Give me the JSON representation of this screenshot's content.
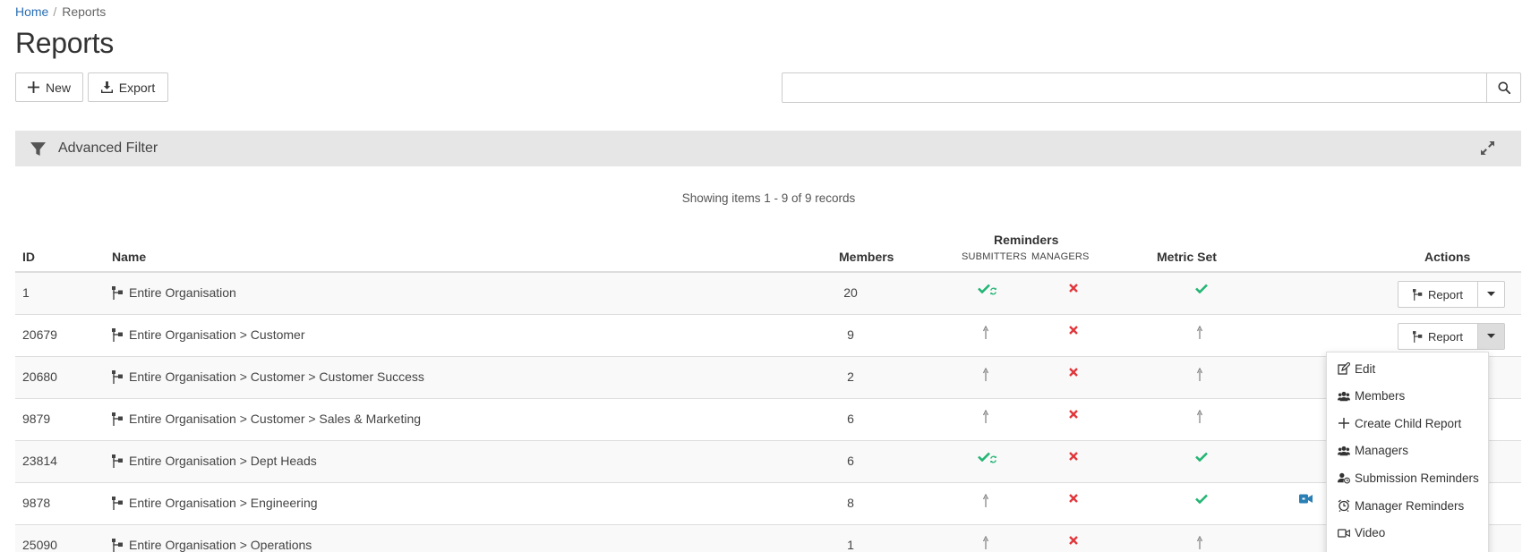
{
  "breadcrumb": {
    "home": "Home",
    "separator": "/",
    "current": "Reports"
  },
  "page_title": "Reports",
  "toolbar": {
    "new_label": "New",
    "export_label": "Export"
  },
  "search": {
    "value": "",
    "placeholder": ""
  },
  "filter": {
    "label": "Advanced Filter"
  },
  "showing_text": "Showing items 1 - 9 of 9 records",
  "table": {
    "headers": {
      "id": "ID",
      "name": "Name",
      "members": "Members",
      "reminders": "Reminders",
      "submitters": "SUBMITTERS",
      "managers": "MANAGERS",
      "metric_set": "Metric Set",
      "actions": "Actions"
    },
    "rows": [
      {
        "id": "1",
        "name": "Entire Organisation",
        "members": "20",
        "submitters": "check-refresh-icon",
        "managers": "cross-icon",
        "metric": "check-icon",
        "video": false
      },
      {
        "id": "20679",
        "name": "Entire Organisation > Customer",
        "members": "9",
        "submitters": "long-arrow-up-icon",
        "managers": "cross-icon",
        "metric": "long-arrow-up-icon",
        "video": false
      },
      {
        "id": "20680",
        "name": "Entire Organisation > Customer > Customer Success",
        "members": "2",
        "submitters": "long-arrow-up-icon",
        "managers": "cross-icon",
        "metric": "long-arrow-up-icon",
        "video": false
      },
      {
        "id": "9879",
        "name": "Entire Organisation > Customer > Sales & Marketing",
        "members": "6",
        "submitters": "long-arrow-up-icon",
        "managers": "cross-icon",
        "metric": "long-arrow-up-icon",
        "video": false
      },
      {
        "id": "23814",
        "name": "Entire Organisation > Dept Heads",
        "members": "6",
        "submitters": "check-refresh-icon",
        "managers": "cross-icon",
        "metric": "check-icon",
        "video": false
      },
      {
        "id": "9878",
        "name": "Entire Organisation > Engineering",
        "members": "8",
        "submitters": "long-arrow-up-icon",
        "managers": "cross-icon",
        "metric": "check-icon",
        "video": true
      },
      {
        "id": "25090",
        "name": "Entire Organisation > Operations",
        "members": "1",
        "submitters": "long-arrow-up-icon",
        "managers": "cross-icon",
        "metric": "long-arrow-up-icon",
        "video": false
      }
    ],
    "action_button_label": "Report"
  },
  "dropdown": {
    "items": [
      {
        "label": "Edit",
        "icon": "edit-icon"
      },
      {
        "label": "Members",
        "icon": "users-icon"
      },
      {
        "label": "Create Child Report",
        "icon": "plus-icon"
      },
      {
        "label": "Managers",
        "icon": "users-icon"
      },
      {
        "label": "Submission Reminders",
        "icon": "user-clock-icon"
      },
      {
        "label": "Manager Reminders",
        "icon": "alarm-clock-icon"
      },
      {
        "label": "Video",
        "icon": "video-icon"
      }
    ]
  },
  "colors": {
    "link": "#2a6fb5",
    "success": "#22b573",
    "danger": "#e0373c",
    "muted": "#888888",
    "video": "#2a7fb5"
  }
}
